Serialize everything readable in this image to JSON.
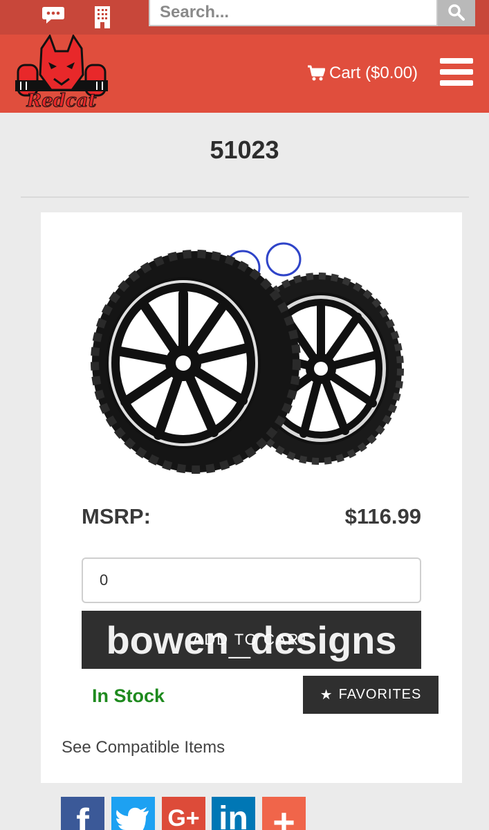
{
  "topbar": {
    "chat_icon": "chat-bubble-icon",
    "building_icon": "building-icon",
    "search": {
      "placeholder": "Search...",
      "value": ""
    },
    "search_button_icon": "search-icon"
  },
  "header": {
    "logo_text": "Redcat",
    "cart_label": "Cart ($0.00)",
    "menu_icon": "hamburger-menu-icon",
    "color": "#e04e3d"
  },
  "product": {
    "title": "51023",
    "msrp_label": "MSRP:",
    "msrp_value": "$116.99",
    "quantity": "0",
    "add_to_cart_label": "ADD TO CART",
    "watermark": "bowen_designs",
    "stock_status": "In Stock",
    "favorites_label": "FAVORITES",
    "compatible_link": "See Compatible Items"
  },
  "social": [
    {
      "label": "f",
      "icon": "facebook-icon",
      "color": "#3b5998"
    },
    {
      "label": "",
      "icon": "twitter-icon",
      "color": "#1da1f2"
    },
    {
      "label": "G+",
      "icon": "google-plus-icon",
      "color": "#dd4b39"
    },
    {
      "label": "in",
      "icon": "linkedin-icon",
      "color": "#0077b5"
    },
    {
      "label": "+",
      "icon": "share-plus-icon",
      "color": "#f0654a"
    }
  ]
}
